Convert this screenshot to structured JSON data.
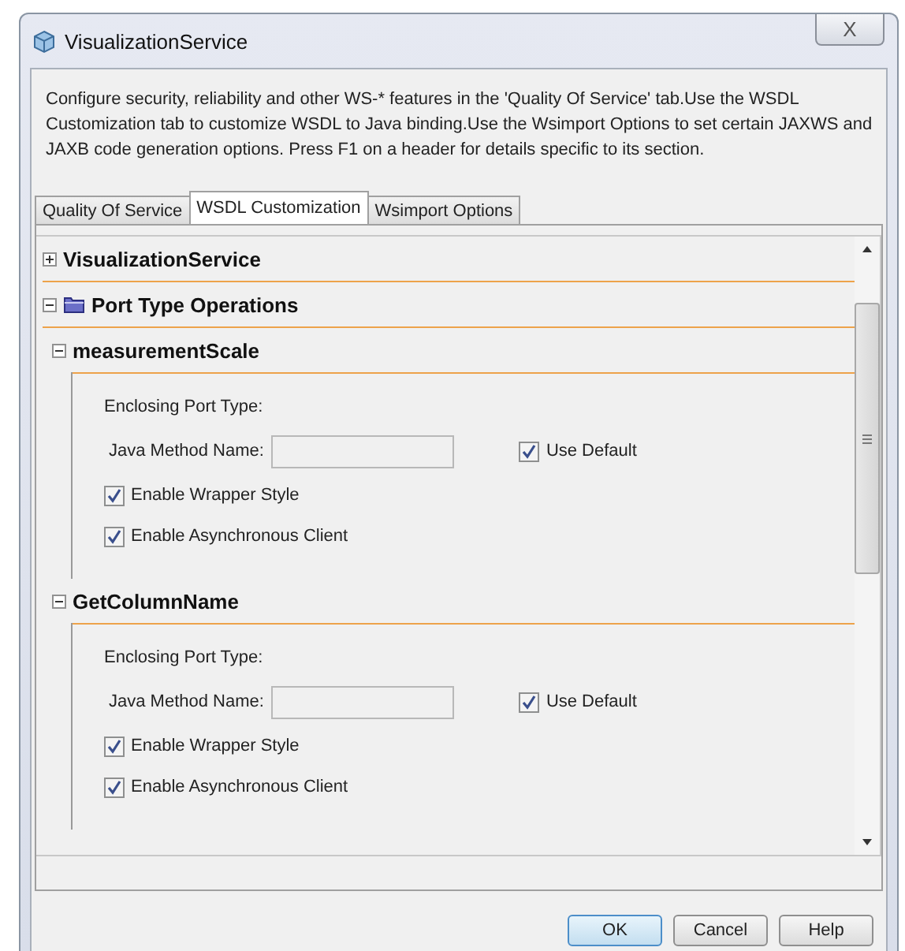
{
  "window": {
    "title": "VisualizationService",
    "close": "X"
  },
  "description": "Configure security, reliability and other WS-* features in the 'Quality Of Service' tab.Use the WSDL Customization tab to customize WSDL to Java binding.Use the Wsimport Options to set certain JAXWS and JAXB code generation options. Press F1 on a header for details specific to its section.",
  "tabs": [
    {
      "label": "Quality Of Service",
      "selected": false
    },
    {
      "label": "WSDL Customization",
      "selected": true
    },
    {
      "label": "Wsimport Options",
      "selected": false
    }
  ],
  "sections": [
    {
      "title": "VisualizationService",
      "expanded": false
    },
    {
      "title": "Port Type Operations",
      "expanded": true,
      "operations": [
        {
          "name": "measurementScale",
          "expanded": true,
          "enclosing_label": "Enclosing Port Type:",
          "method_label": "Java Method Name:",
          "use_default": {
            "label": "Use Default",
            "checked": true
          },
          "wrapper_style": {
            "label": "Enable Wrapper Style",
            "checked": true
          },
          "async_client": {
            "label": "Enable Asynchronous Client",
            "checked": true
          }
        },
        {
          "name": "GetColumnName",
          "expanded": true,
          "enclosing_label": "Enclosing Port Type:",
          "method_label": "Java Method Name:",
          "use_default": {
            "label": "Use Default",
            "checked": true
          },
          "wrapper_style": {
            "label": "Enable Wrapper Style",
            "checked": true
          },
          "async_client": {
            "label": "Enable Asynchronous Client",
            "checked": true
          }
        }
      ]
    }
  ],
  "buttons": [
    {
      "label": "OK",
      "default": true
    },
    {
      "label": "Cancel",
      "default": false
    },
    {
      "label": "Help",
      "default": false
    }
  ]
}
